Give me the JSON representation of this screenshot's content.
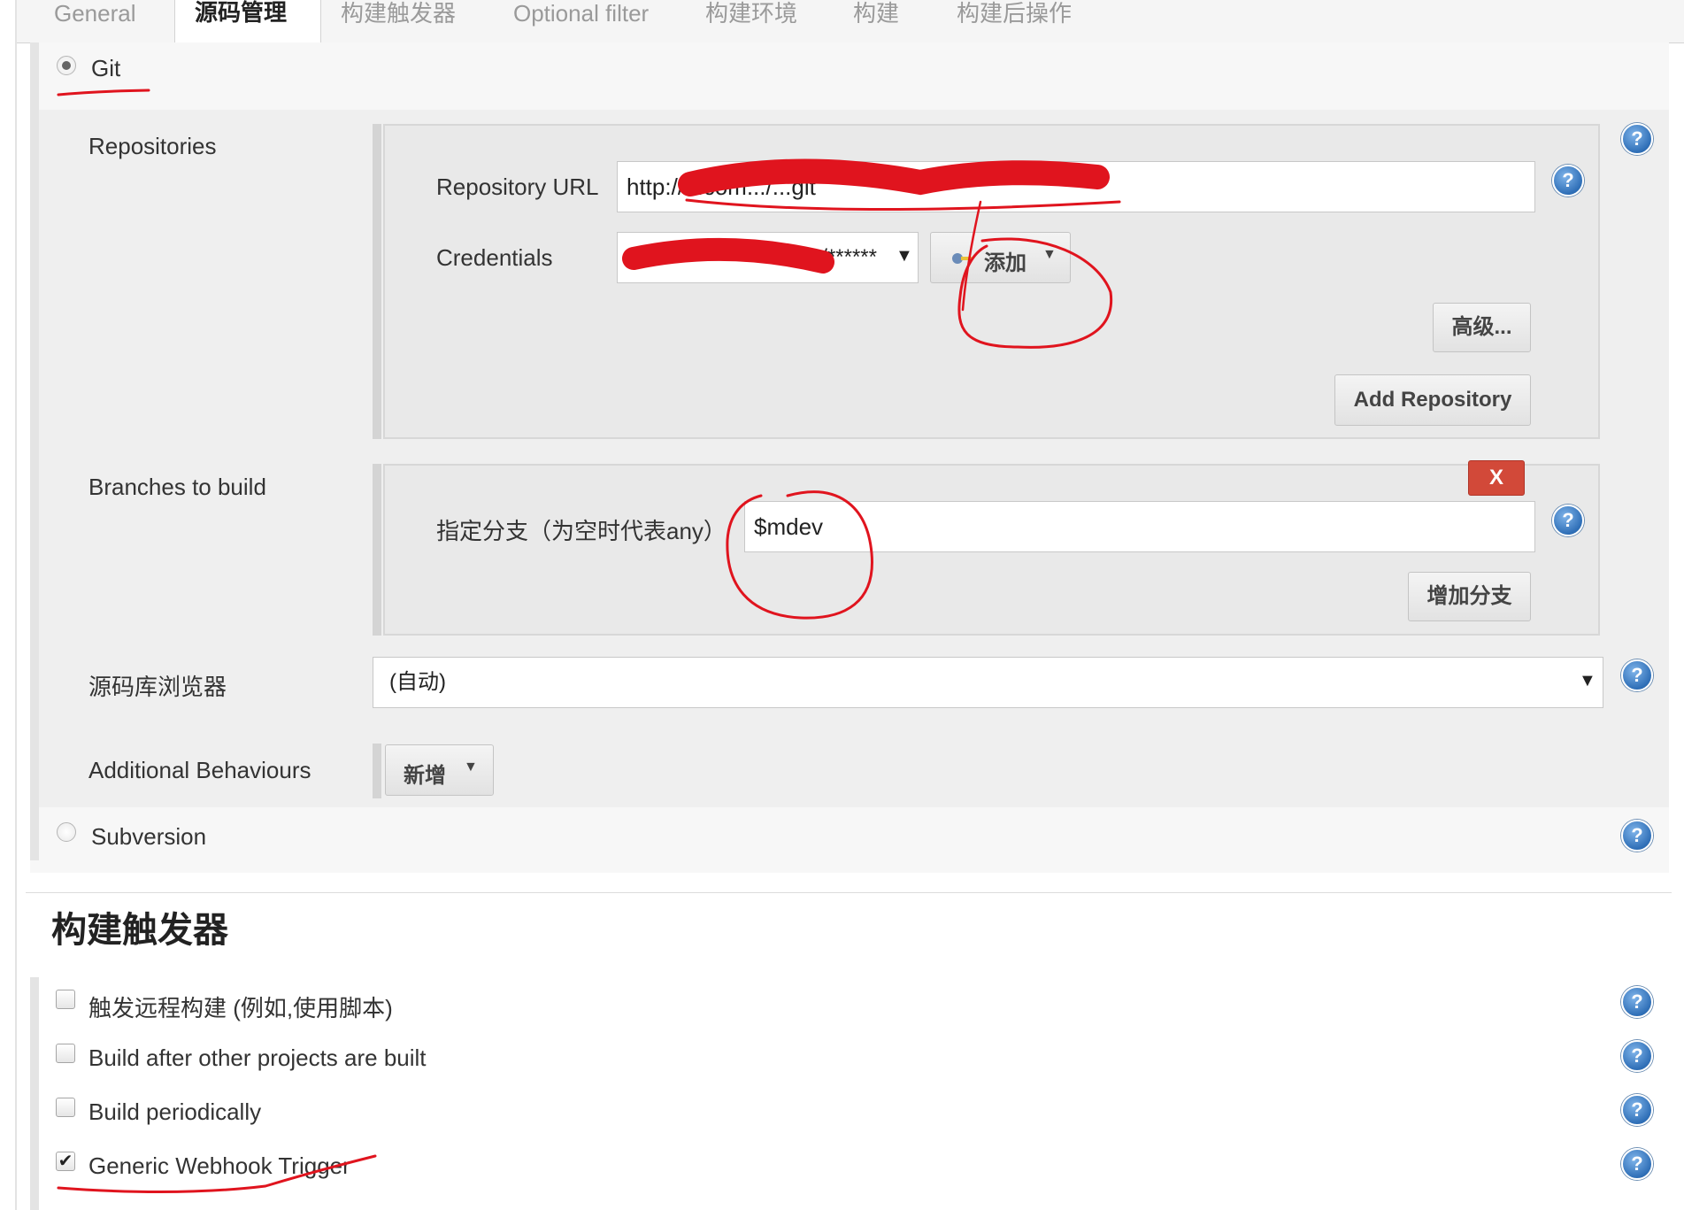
{
  "tabs": [
    "General",
    "源码管理",
    "构建触发器",
    "Optional filter",
    "构建环境",
    "构建",
    "构建后操作"
  ],
  "active_tab": "源码管理",
  "scm": {
    "git_label": "Git",
    "repositories_label": "Repositories",
    "repo_url_label": "Repository URL",
    "repo_url_value": "http://...com.../...git",
    "credentials_label": "Credentials",
    "credentials_value": "/******",
    "add_credentials_label": "添加",
    "advanced_label": "高级...",
    "add_repository_label": "Add Repository",
    "branches_label": "Branches to build",
    "branch_specifier_label": "指定分支（为空时代表any）",
    "branch_value": "$mdev",
    "delete_branch_label": "X",
    "add_branch_label": "增加分支",
    "browser_label": "源码库浏览器",
    "browser_value": "(自动)",
    "additional_behaviours_label": "Additional Behaviours",
    "add_behaviour_label": "新增",
    "subversion_label": "Subversion"
  },
  "triggers": {
    "title": "构建触发器",
    "items": [
      {
        "label": "触发远程构建 (例如,使用脚本)",
        "checked": false
      },
      {
        "label": "Build after other projects are built",
        "checked": false
      },
      {
        "label": "Build periodically",
        "checked": false
      },
      {
        "label": "Generic Webhook Trigger",
        "checked": true
      }
    ]
  },
  "icons": {
    "help": "help-icon",
    "key": "key-icon",
    "dropdown": "dropdown-caret-icon"
  },
  "colors": {
    "annotation_red": "#e0141e",
    "help_blue": "#2f6fb7",
    "delete_red": "#d24939"
  }
}
